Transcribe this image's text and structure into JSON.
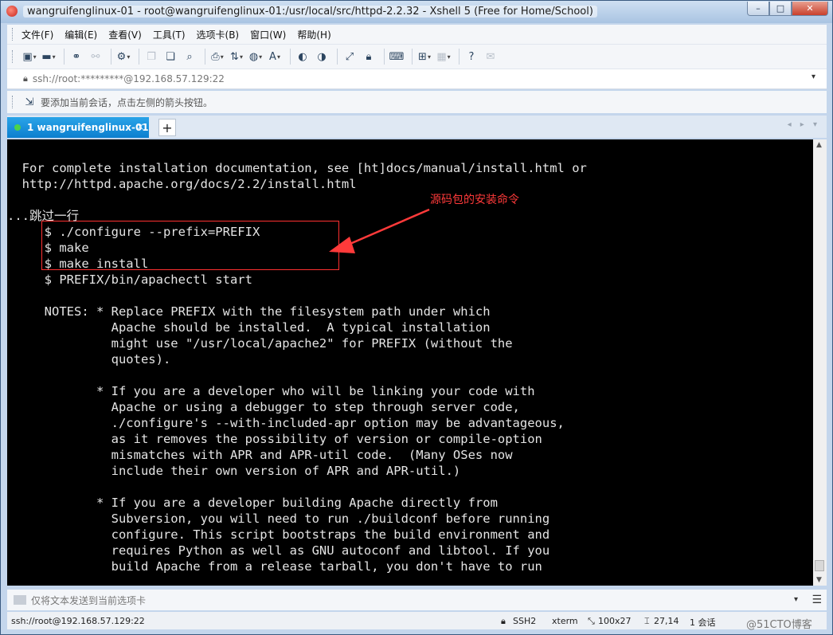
{
  "window": {
    "title": "wangruifenglinux-01 - root@wangruifenglinux-01:/usr/local/src/httpd-2.2.32 - Xshell 5 (Free for Home/School)",
    "controls": [
      "–",
      "□",
      "✕"
    ]
  },
  "menu": [
    "文件(F)",
    "编辑(E)",
    "查看(V)",
    "工具(T)",
    "选项卡(B)",
    "窗口(W)",
    "帮助(H)"
  ],
  "address": "ssh://root:*********@192.168.57.129:22",
  "hint": "要添加当前会话，点击左侧的箭头按钮。",
  "tab": {
    "label": "1 wangruifenglinux-01",
    "close": "×",
    "add": "+"
  },
  "terminal": {
    "lines": [
      "",
      "  For complete installation documentation, see [ht]docs/manual/install.html or",
      "  http://httpd.apache.org/docs/2.2/install.html",
      "",
      "...跳过一行",
      "     $ ./configure --prefix=PREFIX",
      "     $ make",
      "     $ make install",
      "     $ PREFIX/bin/apachectl start",
      "",
      "     NOTES: * Replace PREFIX with the filesystem path under which",
      "              Apache should be installed.  A typical installation",
      "              might use \"/usr/local/apache2\" for PREFIX (without the",
      "              quotes).",
      "",
      "            * If you are a developer who will be linking your code with",
      "              Apache or using a debugger to step through server code,",
      "              ./configure's --with-included-apr option may be advantageous,",
      "              as it removes the possibility of version or compile-option",
      "              mismatches with APR and APR-util code.  (Many OSes now",
      "              include their own version of APR and APR-util.)",
      "",
      "            * If you are a developer building Apache directly from",
      "              Subversion, you will need to run ./buildconf before running",
      "              configure. This script bootstraps the build environment and",
      "              requires Python as well as GNU autoconf and libtool. If you",
      "              build Apache from a release tarball, you don't have to run"
    ],
    "annotation": "源码包的安装命令",
    "annotation_color": "#ff3a3a"
  },
  "send_bar": {
    "placeholder": "仅将文本发送到当前选项卡"
  },
  "status": {
    "connection": "ssh://root@192.168.57.129:22",
    "protocol": "SSH2",
    "terminal_type": "xterm",
    "size": "100x27",
    "cursor": "27,14",
    "sessions": "1 会话",
    "watermark": "@51CTO博客"
  },
  "icons": [
    "new-session-icon",
    "open-folder-icon",
    "connect-icon",
    "disconnect-icon",
    "properties-icon",
    "copy-icon",
    "paste-icon",
    "find-icon",
    "print-icon",
    "transfer-icon",
    "globe-icon",
    "font-icon",
    "xftp-icon",
    "xagent-icon",
    "fullscreen-icon",
    "lock-icon",
    "keyboard-icon",
    "add-icon",
    "layout-icon",
    "help-icon",
    "chat-icon"
  ]
}
